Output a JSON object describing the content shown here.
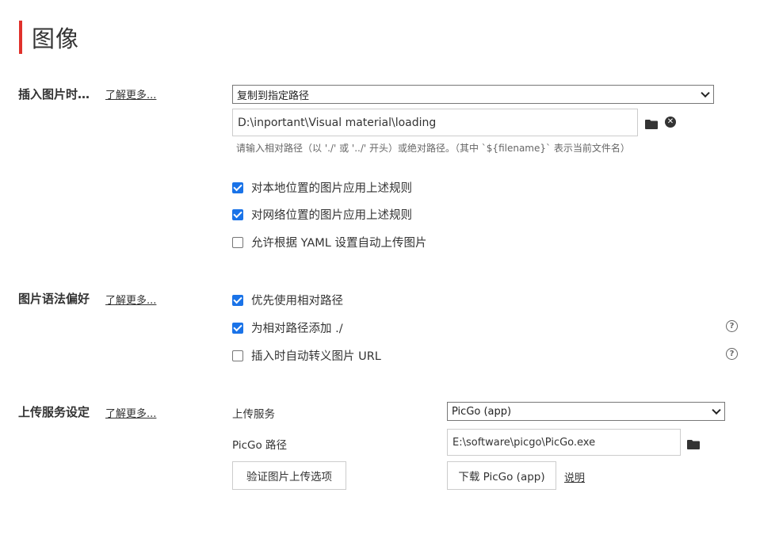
{
  "page": {
    "title": "图像"
  },
  "colors": {
    "accent_bar": "#e0312b",
    "checkbox": "#1a73e8"
  },
  "insert_image": {
    "label": "插入图片时…",
    "learn_more": "了解更多...",
    "action_select": "复制到指定路径",
    "path_value": "D:\\inportant\\Visual material\\loading",
    "path_hint": "请输入相对路径（以 './' 或 '../' 开头）或绝对路径。（其中 `${filename}` 表示当前文件名）",
    "icons": {
      "browse": "folder-icon",
      "clear": "close-circle-icon"
    },
    "options": [
      {
        "label": "对本地位置的图片应用上述规则",
        "checked": true
      },
      {
        "label": "对网络位置的图片应用上述规则",
        "checked": true
      },
      {
        "label": "允许根据 YAML 设置自动上传图片",
        "checked": false
      }
    ]
  },
  "syntax_pref": {
    "label": "图片语法偏好",
    "learn_more": "了解更多...",
    "options": [
      {
        "label": "优先使用相对路径",
        "checked": true,
        "help": false
      },
      {
        "label": "为相对路径添加 ./",
        "checked": true,
        "help": true
      },
      {
        "label": "插入时自动转义图片 URL",
        "checked": false,
        "help": true
      }
    ],
    "help_icon_glyph": "?"
  },
  "upload": {
    "label": "上传服务设定",
    "learn_more": "了解更多...",
    "service_label": "上传服务",
    "service_select": "PicGo (app)",
    "picgo_path_label": "PicGo 路径",
    "picgo_path_value": "E:\\software\\picgo\\PicGo.exe",
    "verify_button": "验证图片上传选项",
    "download_button": "下载 PicGo (app)",
    "explain_link": "说明"
  }
}
